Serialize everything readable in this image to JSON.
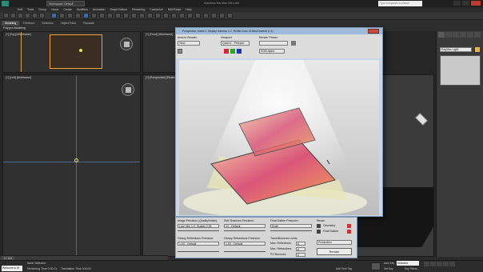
{
  "title_bar": {
    "workspace": "Workspace: Default",
    "app_title": "Autodesk 3ds Max 2014 x64",
    "search_placeholder": "Type a keyword or phrase"
  },
  "menu": [
    "Edit",
    "Tools",
    "Group",
    "Views",
    "Create",
    "Modifiers",
    "Animation",
    "Graph Editors",
    "Rendering",
    "Customize",
    "MAXScript",
    "Help"
  ],
  "ribbon": {
    "tabs": [
      "Modeling",
      "Freeform",
      "Selection",
      "Object Paint",
      "Populate"
    ],
    "sub_label": "Polygon Modeling"
  },
  "viewports": {
    "top_left": "[+] [Top] [Wireframe]",
    "top_right": "[+] [Front] [Wireframe]",
    "bottom_left": "[+] [Left] [Wireframe]",
    "bottom_right": "[+] [Perspective] [Realistic]"
  },
  "command_panel": {
    "name_field": "RayMax Light"
  },
  "render_window": {
    "title": "Perspective, frame 0, Display Gamma: 2.2, RGBA Color 16 Bits/Channel (1:1)",
    "area_to_render_label": "Area to Render:",
    "area_to_render_value": "View",
    "viewport_label": "Viewport:",
    "viewport_value": "Quad 4 - Perspec",
    "render_preset_label": "Render Preset:",
    "channel_value": "RGB Alpha"
  },
  "iray_panel": {
    "image_precision_label": "Image Precision (Quality/Noise):",
    "image_precision_value": "Low: Min 1.0, Quality 0.25",
    "soft_shadows_label": "Soft Shadows Precision:",
    "soft_shadows_value": "1X - Default",
    "final_gather_label": "Final Gather Precision:",
    "final_gather_value": "Draft",
    "reuse_label": "Reuse",
    "geometry_label": "Geometry",
    "final_gather_check_label": "Final Gather",
    "glossy_reflections_label": "Glossy Reflections Precision:",
    "glossy_reflections_value": "1.0X - Default",
    "glossy_refractions_label": "Glossy Refractions Precision:",
    "glossy_refractions_value": "1.0X - Default",
    "trace_limits_label": "Trace/Bounces Limits",
    "max_reflections_label": "Max. Reflections",
    "max_reflections_value": "6",
    "max_refractions_label": "Max. Refractions",
    "max_refractions_value": "6",
    "fg_bounces_label": "FG Bounces",
    "fg_bounces_value": "0",
    "production_value": "Production",
    "render_button": "Render"
  },
  "status_bar": {
    "frame_counter": "0 / 100",
    "welcome_text": "Welcome to M",
    "none_selected": "None Selected",
    "rendering_time": "Rendering Time 0:00:11",
    "translation_time": "Translation Time 0:00:00",
    "selected_label": "Selected",
    "auto_key_label": "Auto Key",
    "set_key_label": "Set Key",
    "key_filters_label": "Key Filters...",
    "add_time_tag": "Add Time Tag"
  },
  "accent_colors": {
    "selection": "#f5a033",
    "toolbar_blue": "#2e6fb5",
    "window_frame": "#9dbad8"
  }
}
